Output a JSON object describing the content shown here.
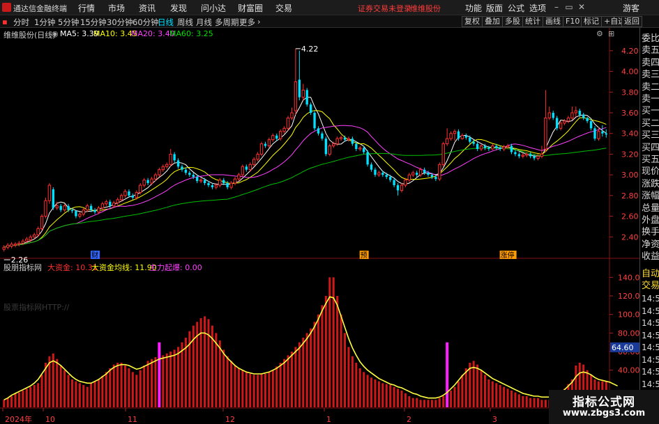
{
  "menubar": {
    "app_title": "通达信金融终端",
    "items": [
      "行情",
      "市场",
      "资讯",
      "发现",
      "问小达",
      "财富圈",
      "交易"
    ],
    "status_text": "证券交易未登录",
    "stock_link": "维维股份",
    "right_items": [
      "功能",
      "版面",
      "公式",
      "选项"
    ],
    "guest": "游客"
  },
  "toolbar": {
    "periods": [
      "分时",
      "1分钟",
      "5分钟",
      "15分钟",
      "30分钟",
      "60分钟",
      "日线",
      "周线",
      "月线",
      "多周期",
      "更多"
    ],
    "active_period": "日线",
    "right_buttons": [
      "复权",
      "叠加",
      "多股",
      "统计",
      "画线",
      "F10",
      "标记",
      "+自选",
      "返回"
    ]
  },
  "price_panel": {
    "title": "维维股份(日线)",
    "ma_labels": [
      {
        "text": "MA5: 3.39",
        "color": "#ffffff"
      },
      {
        "text": "MA10: 3.45",
        "color": "#ffff00"
      },
      {
        "text": "MA20: 3.40",
        "color": "#ff40ff"
      },
      {
        "text": "MA60: 3.25",
        "color": "#00e000"
      }
    ],
    "high_label": "4.22",
    "low_label": "2.26",
    "y_ticks": [
      "4.20",
      "4.00",
      "3.80",
      "3.60",
      "3.40",
      "3.20",
      "3.00",
      "2.80",
      "2.60",
      "2.40"
    ],
    "event_markers": [
      {
        "text": "财",
        "color": "#3366ff"
      },
      {
        "text": "预",
        "color": "#ff9900"
      },
      {
        "text": "涨停",
        "color": "#ff9900"
      }
    ]
  },
  "indicator_panel": {
    "name": "股朋指标网",
    "labels": [
      {
        "text": "大资金: 10.31",
        "color": "#ff3030"
      },
      {
        "text": "大资金均线: 11.90",
        "color": "#ffff00"
      },
      {
        "text": "主力起爆: 0.00",
        "color": "#ff40ff"
      }
    ],
    "faint_watermark": "股票指标网HTTP://",
    "y_ticks": [
      "140.00",
      "120.00",
      "100.00",
      "80.00",
      "60.00",
      "40.00"
    ],
    "current_value": "64.60"
  },
  "x_axis": {
    "labels": [
      "2024年",
      "10",
      "11",
      "12",
      "1",
      "2",
      "3"
    ]
  },
  "right_panel": {
    "labels": [
      "委比",
      "卖五",
      "卖四",
      "卖三",
      "卖二",
      "卖一",
      "买一",
      "买二",
      "买三",
      "买四",
      "买五",
      "现价",
      "涨跌",
      "涨幅",
      "总量",
      "外盘",
      "换手",
      "净资",
      "收益"
    ],
    "auto_trade": [
      "自动",
      "交易"
    ],
    "times": [
      "14:5",
      "14:5",
      "14:5",
      "14:5",
      "14:5",
      "14:5",
      "14:5",
      "14:5",
      "14:5",
      "14:5",
      "14:5"
    ]
  },
  "watermark": {
    "line1": "指标公式网",
    "line2": "www.zbgs3.com"
  },
  "chart_data": {
    "type": "candlestick",
    "price_range": [
      2.2,
      4.3
    ],
    "close": [
      2.3,
      2.32,
      2.33,
      2.33,
      2.34,
      2.36,
      2.38,
      2.4,
      2.42,
      2.48,
      2.6,
      2.75,
      2.9,
      2.68,
      2.7,
      2.66,
      2.7,
      2.66,
      2.65,
      2.6,
      2.62,
      2.66,
      2.7,
      2.66,
      2.64,
      2.68,
      2.72,
      2.74,
      2.7,
      2.73,
      2.76,
      2.8,
      2.84,
      2.8,
      2.78,
      2.83,
      2.9,
      2.95,
      2.92,
      2.96,
      3.0,
      3.05,
      3.08,
      3.1,
      3.2,
      3.14,
      3.08,
      3.05,
      3.02,
      3.0,
      2.98,
      2.94,
      2.95,
      2.92,
      2.9,
      2.88,
      2.9,
      2.95,
      2.92,
      2.88,
      2.92,
      2.96,
      3.0,
      3.08,
      3.05,
      3.1,
      3.15,
      3.2,
      3.3,
      3.28,
      3.34,
      3.38,
      3.35,
      3.42,
      3.45,
      3.55,
      3.6,
      3.9,
      3.75,
      3.82,
      3.68,
      3.6,
      3.45,
      3.4,
      3.35,
      3.2,
      3.28,
      3.3,
      3.35,
      3.36,
      3.34,
      3.35,
      3.3,
      3.25,
      3.26,
      3.22,
      3.1,
      3.05,
      3.0,
      3.02,
      3.0,
      2.98,
      2.95,
      2.9,
      2.85,
      2.9,
      2.95,
      3.0,
      3.02,
      3.0,
      3.05,
      3.02,
      3.0,
      2.98,
      2.96,
      3.1,
      3.3,
      3.35,
      3.4,
      3.42,
      3.35,
      3.38,
      3.36,
      3.32,
      3.3,
      3.25,
      3.28,
      3.26,
      3.25,
      3.28,
      3.26,
      3.25,
      3.27,
      3.28,
      3.22,
      3.2,
      3.18,
      3.19,
      3.2,
      3.18,
      3.16,
      3.18,
      3.2,
      3.55,
      3.6,
      3.55,
      3.45,
      3.5,
      3.52,
      3.55,
      3.6,
      3.62,
      3.58,
      3.55,
      3.52,
      3.45,
      3.35,
      3.42,
      3.4,
      3.39
    ],
    "open": [
      2.28,
      2.3,
      2.31,
      2.32,
      2.33,
      2.34,
      2.36,
      2.37,
      2.4,
      2.42,
      2.48,
      2.6,
      2.75,
      2.86,
      2.68,
      2.7,
      2.66,
      2.7,
      2.66,
      2.65,
      2.6,
      2.62,
      2.66,
      2.7,
      2.66,
      2.64,
      2.68,
      2.72,
      2.74,
      2.7,
      2.73,
      2.76,
      2.8,
      2.84,
      2.8,
      2.78,
      2.83,
      2.9,
      2.95,
      2.92,
      2.96,
      3.0,
      3.05,
      3.08,
      3.1,
      3.2,
      3.14,
      3.08,
      3.05,
      3.02,
      3.0,
      2.98,
      2.94,
      2.95,
      2.92,
      2.9,
      2.88,
      2.9,
      2.95,
      2.92,
      2.88,
      2.92,
      2.96,
      3.0,
      3.08,
      3.05,
      3.1,
      3.15,
      3.2,
      3.3,
      3.28,
      3.34,
      3.38,
      3.35,
      3.42,
      3.45,
      3.55,
      3.62,
      3.92,
      3.75,
      3.82,
      3.68,
      3.6,
      3.45,
      3.4,
      3.35,
      3.2,
      3.28,
      3.3,
      3.35,
      3.36,
      3.34,
      3.35,
      3.3,
      3.25,
      3.26,
      3.22,
      3.1,
      3.05,
      3.0,
      3.02,
      3.0,
      2.98,
      2.95,
      2.9,
      2.85,
      2.9,
      2.95,
      3.0,
      3.02,
      3.0,
      3.05,
      3.02,
      3.0,
      2.98,
      2.96,
      3.1,
      3.3,
      3.35,
      3.4,
      3.42,
      3.35,
      3.38,
      3.36,
      3.32,
      3.3,
      3.25,
      3.28,
      3.26,
      3.25,
      3.28,
      3.26,
      3.25,
      3.27,
      3.28,
      3.22,
      3.2,
      3.18,
      3.19,
      3.2,
      3.18,
      3.16,
      3.18,
      3.25,
      3.55,
      3.6,
      3.55,
      3.45,
      3.5,
      3.52,
      3.55,
      3.6,
      3.62,
      3.58,
      3.55,
      3.52,
      3.45,
      3.35,
      3.42,
      3.4
    ],
    "high": [
      2.32,
      2.34,
      2.35,
      2.35,
      2.36,
      2.38,
      2.4,
      2.42,
      2.44,
      2.5,
      2.62,
      2.78,
      2.92,
      2.88,
      2.74,
      2.72,
      2.72,
      2.72,
      2.68,
      2.66,
      2.64,
      2.68,
      2.72,
      2.72,
      2.68,
      2.7,
      2.74,
      2.76,
      2.76,
      2.75,
      2.78,
      2.82,
      2.86,
      2.86,
      2.82,
      2.85,
      2.92,
      2.97,
      2.97,
      2.98,
      3.02,
      3.07,
      3.1,
      3.12,
      3.25,
      3.22,
      3.16,
      3.1,
      3.07,
      3.04,
      3.02,
      3.0,
      2.97,
      2.97,
      2.94,
      2.92,
      2.92,
      2.97,
      2.97,
      2.94,
      2.94,
      2.98,
      3.02,
      3.1,
      3.1,
      3.12,
      3.17,
      3.22,
      3.32,
      3.32,
      3.36,
      3.4,
      3.4,
      3.44,
      3.47,
      3.57,
      3.65,
      4.22,
      4.2,
      3.88,
      3.84,
      3.7,
      3.62,
      3.47,
      3.42,
      3.37,
      3.3,
      3.32,
      3.37,
      3.38,
      3.38,
      3.37,
      3.37,
      3.32,
      3.28,
      3.28,
      3.24,
      3.12,
      3.07,
      3.04,
      3.04,
      3.02,
      3.0,
      2.97,
      2.92,
      2.92,
      2.97,
      3.02,
      3.04,
      3.04,
      3.07,
      3.07,
      3.04,
      3.02,
      3.0,
      3.12,
      3.32,
      3.45,
      3.42,
      3.44,
      3.44,
      3.4,
      3.4,
      3.38,
      3.34,
      3.32,
      3.3,
      3.3,
      3.28,
      3.3,
      3.3,
      3.28,
      3.29,
      3.3,
      3.3,
      3.24,
      3.22,
      3.21,
      3.22,
      3.22,
      3.2,
      3.2,
      3.28,
      3.82,
      3.66,
      3.62,
      3.57,
      3.52,
      3.54,
      3.57,
      3.66,
      3.66,
      3.64,
      3.6,
      3.56,
      3.54,
      3.47,
      3.46,
      3.48,
      3.44
    ],
    "low": [
      2.26,
      2.28,
      2.29,
      2.3,
      2.31,
      2.32,
      2.34,
      2.35,
      2.38,
      2.4,
      2.46,
      2.58,
      2.72,
      2.66,
      2.66,
      2.64,
      2.64,
      2.64,
      2.63,
      2.58,
      2.58,
      2.6,
      2.64,
      2.64,
      2.62,
      2.62,
      2.66,
      2.7,
      2.68,
      2.68,
      2.71,
      2.74,
      2.78,
      2.78,
      2.76,
      2.76,
      2.81,
      2.88,
      2.9,
      2.9,
      2.94,
      2.98,
      3.03,
      3.06,
      3.08,
      3.12,
      3.06,
      3.03,
      3.0,
      2.98,
      2.96,
      2.92,
      2.92,
      2.9,
      2.88,
      2.86,
      2.86,
      2.88,
      2.9,
      2.86,
      2.86,
      2.9,
      2.94,
      2.98,
      3.03,
      3.03,
      3.08,
      3.13,
      3.18,
      3.26,
      3.26,
      3.32,
      3.33,
      3.33,
      3.4,
      3.43,
      3.53,
      3.58,
      3.72,
      3.72,
      3.66,
      3.58,
      3.43,
      3.38,
      3.33,
      3.18,
      3.18,
      3.26,
      3.28,
      3.33,
      3.32,
      3.32,
      3.28,
      3.23,
      3.23,
      3.2,
      3.08,
      3.03,
      2.98,
      2.98,
      2.98,
      2.96,
      2.93,
      2.88,
      2.8,
      2.83,
      2.88,
      2.93,
      2.98,
      2.98,
      2.98,
      3.0,
      2.98,
      2.96,
      2.94,
      2.94,
      3.08,
      3.28,
      3.33,
      3.33,
      3.33,
      3.34,
      3.34,
      3.3,
      3.28,
      3.23,
      3.23,
      3.24,
      3.23,
      3.24,
      3.24,
      3.23,
      3.23,
      3.25,
      3.2,
      3.18,
      3.16,
      3.16,
      3.17,
      3.16,
      3.14,
      3.14,
      3.16,
      3.22,
      3.53,
      3.53,
      3.43,
      3.43,
      3.48,
      3.5,
      3.53,
      3.56,
      3.56,
      3.53,
      3.5,
      3.43,
      3.33,
      3.33,
      3.37,
      3.36
    ],
    "indicator": {
      "big_funds": [
        8,
        10,
        12,
        15,
        16,
        18,
        20,
        22,
        24,
        26,
        35,
        48,
        55,
        58,
        52,
        45,
        40,
        35,
        30,
        28,
        26,
        24,
        22,
        26,
        28,
        30,
        34,
        38,
        42,
        46,
        48,
        48,
        45,
        42,
        38,
        35,
        40,
        45,
        50,
        52,
        54,
        56,
        56,
        58,
        60,
        62,
        65,
        70,
        75,
        82,
        88,
        92,
        96,
        98,
        95,
        88,
        80,
        72,
        62,
        55,
        50,
        45,
        42,
        40,
        38,
        36,
        35,
        35,
        36,
        36,
        38,
        40,
        44,
        48,
        52,
        56,
        60,
        65,
        70,
        75,
        80,
        85,
        92,
        100,
        110,
        120,
        140,
        140,
        120,
        100,
        80,
        65,
        55,
        48,
        42,
        38,
        35,
        32,
        30,
        28,
        26,
        25,
        24,
        22,
        20,
        18,
        15,
        12,
        10,
        10,
        8,
        8,
        8,
        8,
        8,
        10,
        12,
        14,
        18,
        22,
        28,
        35,
        42,
        48,
        50,
        46,
        40,
        35,
        30,
        28,
        26,
        24,
        22,
        20,
        18,
        16,
        14,
        12,
        12,
        10,
        10,
        10,
        8,
        8,
        8,
        10,
        12,
        15,
        20,
        25,
        30,
        45,
        48,
        46,
        40,
        35,
        30,
        28,
        28,
        28,
        25,
        22,
        18
      ],
      "moving_avg": [
        8,
        10,
        13,
        15,
        17,
        19,
        21,
        23,
        26,
        30,
        36,
        42,
        48,
        50,
        48,
        45,
        41,
        37,
        33,
        30,
        28,
        27,
        26,
        26,
        28,
        30,
        33,
        36,
        40,
        43,
        45,
        46,
        46,
        45,
        43,
        41,
        42,
        44,
        46,
        48,
        50,
        52,
        53,
        54,
        55,
        56,
        58,
        61,
        64,
        68,
        73,
        77,
        80,
        80,
        78,
        74,
        69,
        64,
        58,
        53,
        49,
        45,
        42,
        40,
        38,
        37,
        36,
        36,
        36,
        37,
        38,
        40,
        42,
        45,
        48,
        52,
        56,
        60,
        64,
        69,
        74,
        80,
        87,
        95,
        104,
        112,
        119,
        118,
        110,
        98,
        86,
        74,
        64,
        56,
        49,
        44,
        40,
        37,
        34,
        31,
        29,
        27,
        25,
        24,
        22,
        21,
        19,
        17,
        15,
        14,
        12,
        11,
        10,
        10,
        10,
        11,
        13,
        16,
        20,
        24,
        29,
        34,
        38,
        42,
        43,
        42,
        40,
        37,
        34,
        31,
        29,
        27,
        25,
        23,
        21,
        19,
        17,
        15,
        14,
        13,
        12,
        12,
        11,
        11,
        11,
        12,
        14,
        16,
        19,
        23,
        27,
        33,
        37,
        38,
        37,
        35,
        32,
        30,
        29,
        28,
        27,
        25,
        23
      ],
      "breakout_bars": [
        41,
        117
      ]
    }
  }
}
